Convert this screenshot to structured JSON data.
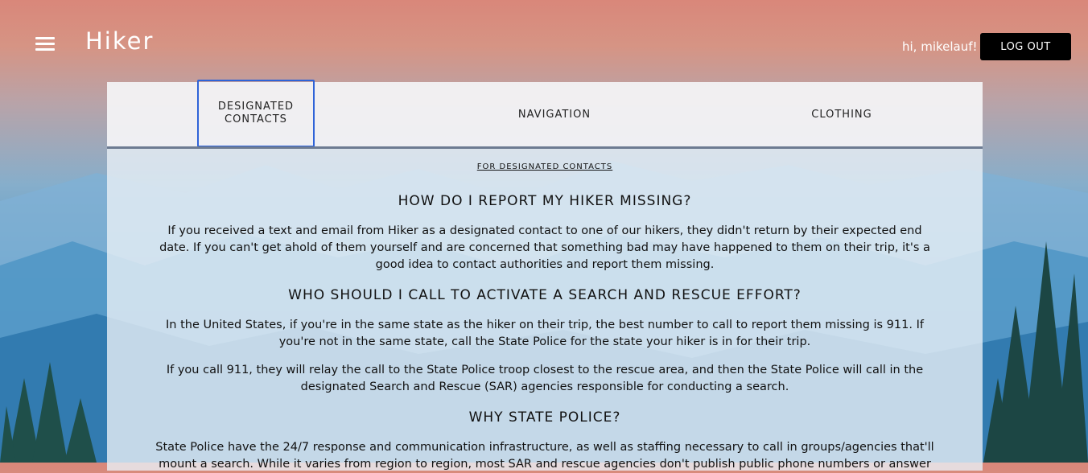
{
  "header": {
    "brand": "Hiker",
    "greeting": "hi, mikelauf!",
    "logout_label": "LOG OUT"
  },
  "tabs": [
    {
      "label_line1": "DESIGNATED",
      "label_line2": "CONTACTS",
      "active": true
    },
    {
      "label": "NAVIGATION"
    },
    {
      "label": "CLOTHING"
    }
  ],
  "content": {
    "section_link": "FOR DESIGNATED CONTACTS",
    "q1": "HOW DO I REPORT MY HIKER MISSING?",
    "a1": "If you received a text and email from Hiker as a designated contact to one of our hikers, they didn't return by their expected end date. If you can't get ahold of them yourself and are concerned that something bad may have happened to them on their trip, it's a good idea to contact authorities and report them missing.",
    "q2": "WHO SHOULD I CALL TO ACTIVATE A SEARCH AND RESCUE EFFORT?",
    "a2_p1": "In the United States, if you're in the same state as the hiker on their trip, the best number to call to report them missing is 911. If you're not in the same state, call the State Police for the state your hiker is in for their trip.",
    "a2_p2": "If you call 911, they will relay the call to the State Police troop closest to the rescue area, and then the State Police will call in the designated Search and Rescue (SAR) agencies responsible for conducting a search.",
    "q3": "WHY STATE POLICE?",
    "a3": "State Police have the 24/7 response and communication infrastructure, as well as staffing necessary to call in groups/agencies that'll mount a search. While it varies from region to region, most SAR and rescue agencies don't publish public phone numbers or answer"
  },
  "colors": {
    "tab_focus": "#2f63d8",
    "tab_underline": "#6d7b92",
    "logout_bg": "#000000"
  },
  "icons": {
    "menu": "hamburger-menu-icon"
  }
}
